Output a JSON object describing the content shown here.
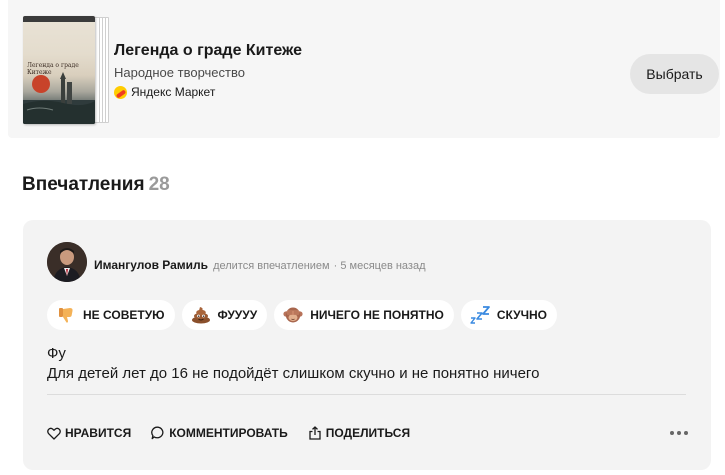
{
  "book": {
    "title": "Легенда о граде Китеже",
    "author": "Народное творчество",
    "market_label": "Яндекс Маркет",
    "market_icon": "yandex-market-logo-icon",
    "choose_label": "Выбрать",
    "cover_title": "Легенда о граде Китеже"
  },
  "impressions": {
    "title": "Впечатления",
    "count": "28"
  },
  "review": {
    "author": "Имангулов Рамиль",
    "action": "делится впечатлением",
    "time": "· 5 месяцев назад",
    "reactions": [
      {
        "label": "НЕ СОВЕТУЮ",
        "icon": "thumbs-down-icon"
      },
      {
        "label": "ФУУУУ",
        "icon": "poop-icon"
      },
      {
        "label": "НИЧЕГО НЕ ПОНЯТНО",
        "icon": "see-no-evil-monkey-icon"
      },
      {
        "label": "СКУЧНО",
        "icon": "zzz-icon"
      }
    ],
    "text_line1": "Фу",
    "text_line2": "Для детей лет до 16 не подойдёт слишком скучно и не понятно ничего"
  },
  "actions": {
    "like": "НРАВИТСЯ",
    "comment": "КОММЕНТИРОВАТЬ",
    "share": "ПОДЕЛИТЬСЯ"
  },
  "colors": {
    "card_bg": "#f3f3f3",
    "button_bg": "#e5e5e5",
    "count_gray": "#9a9a9a"
  }
}
